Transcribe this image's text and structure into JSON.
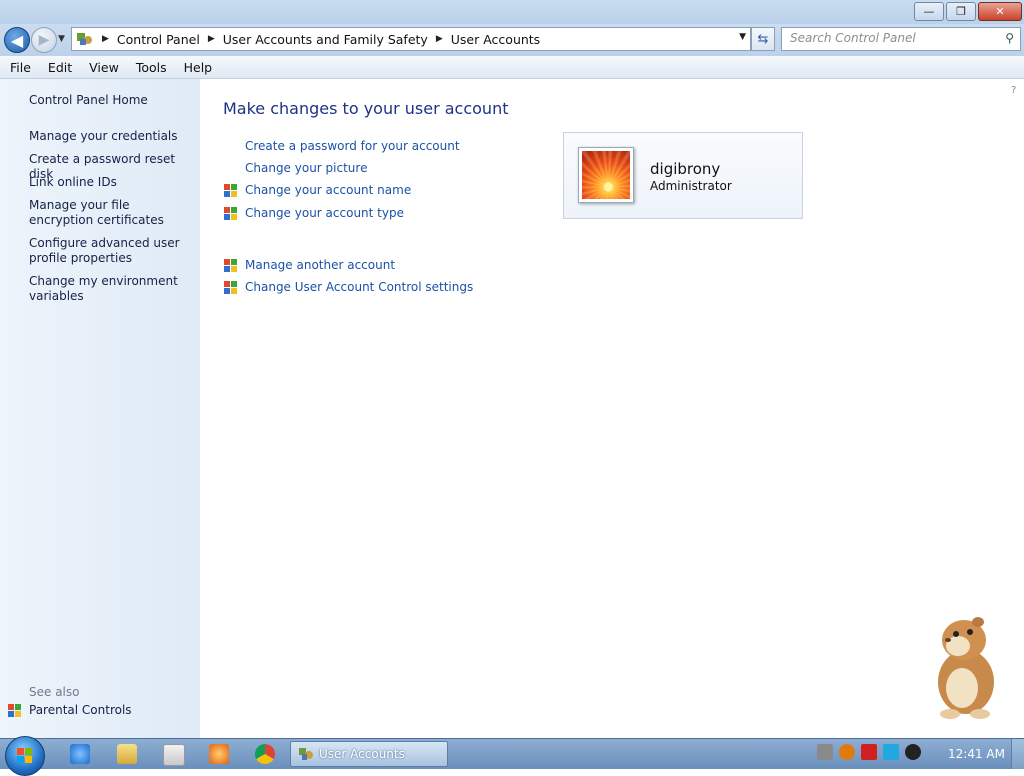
{
  "window": {
    "minimize": "—",
    "restore": "❐",
    "close": "✕"
  },
  "address": {
    "crumbs": [
      "Control Panel",
      "User Accounts and Family Safety",
      "User Accounts"
    ]
  },
  "search": {
    "placeholder": "Search Control Panel"
  },
  "menu": [
    "File",
    "Edit",
    "View",
    "Tools",
    "Help"
  ],
  "sidebar": {
    "home": "Control Panel Home",
    "links": [
      "Manage your credentials",
      "Create a password reset disk",
      "Link online IDs",
      "Manage your file encryption certificates",
      "Configure advanced user profile properties",
      "Change my environment variables"
    ],
    "see_also": "See also",
    "parental": "Parental Controls"
  },
  "main": {
    "heading": "Make changes to your user account",
    "tasks": [
      "Create a password for your account",
      "Change your picture",
      "Change your account name",
      "Change your account type"
    ],
    "other_tasks": [
      "Manage another account",
      "Change User Account Control settings"
    ]
  },
  "account": {
    "name": "digibrony",
    "role": "Administrator"
  },
  "taskbar": {
    "active_task": "User Accounts",
    "clock": "12:41 AM"
  },
  "colors": {
    "link": "#1c51a8",
    "heading": "#1e3287",
    "taskbar": "#6a8fbd"
  }
}
